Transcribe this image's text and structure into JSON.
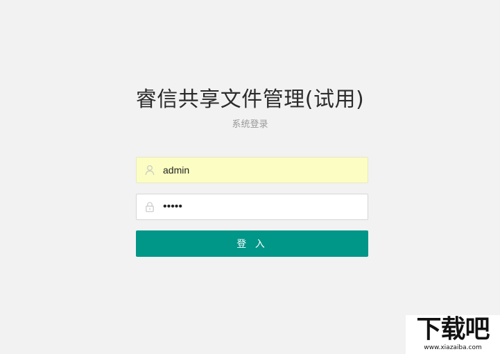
{
  "header": {
    "title": "睿信共享文件管理(试用)",
    "subtitle": "系统登录"
  },
  "form": {
    "username": {
      "icon": "user-icon",
      "value": "admin"
    },
    "password": {
      "icon": "lock-icon",
      "value": "•••••"
    },
    "login_label": "登 入"
  },
  "watermark": {
    "logo_text": "下载吧",
    "url": "www.xiazaiba.com"
  },
  "colors": {
    "accent": "#009688",
    "background": "#f2f2f2",
    "autofill": "#fbfdc2"
  }
}
